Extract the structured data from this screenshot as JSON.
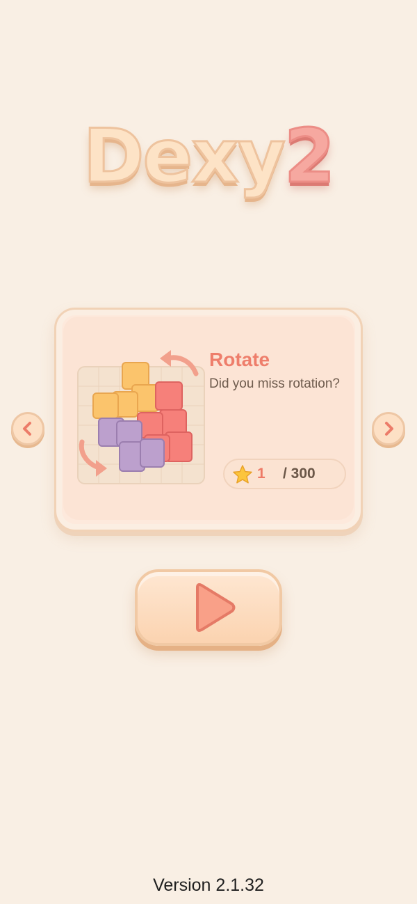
{
  "app": {
    "logo_main": "Dexy",
    "logo_number": "2",
    "version": "Version 2.1.32"
  },
  "mode_card": {
    "title": "Rotate",
    "description": "Did you miss rotation?",
    "progress_current": "1",
    "progress_total": "/ 300",
    "icons": {
      "artwork": "rotating-blocks-illustration",
      "star": "star-icon"
    }
  },
  "navigation": {
    "prev_icon": "chevron-left-icon",
    "next_icon": "chevron-right-icon",
    "play_icon": "play-icon"
  },
  "colors": {
    "background": "#f9efe4",
    "accent": "#ee7e6b",
    "card": "#fde9dc"
  }
}
